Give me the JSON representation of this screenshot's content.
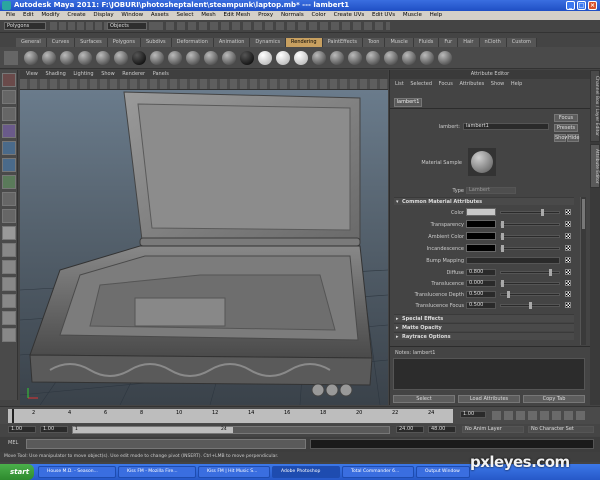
{
  "window": {
    "title": "Autodesk Maya 2011: F:\\JOBURI\\photosheptalent\\steampunk\\laptop.mb* --- lambert1",
    "minimize": "_",
    "maximize": "□",
    "close": "×"
  },
  "menubar": [
    "File",
    "Edit",
    "Modify",
    "Create",
    "Display",
    "Window",
    "Assets",
    "Select",
    "Mesh",
    "Edit Mesh",
    "Proxy",
    "Normals",
    "Color",
    "Create UVs",
    "Edit UVs",
    "Muscle",
    "Help"
  ],
  "status": {
    "mode": "Polygons",
    "objects_field": "Objects"
  },
  "shelf": {
    "tabs": [
      "General",
      "Curves",
      "Surfaces",
      "Polygons",
      "Subdivs",
      "Deformation",
      "Animation",
      "Dynamics",
      "Rendering",
      "PaintEffects",
      "Toon",
      "Muscle",
      "Fluids",
      "Fur",
      "Hair",
      "nCloth",
      "Custom"
    ],
    "active_tab": "Rendering"
  },
  "viewport": {
    "menu": [
      "View",
      "Shading",
      "Lighting",
      "Show",
      "Renderer",
      "Panels"
    ]
  },
  "attribute_editor": {
    "title": "Attribute Editor",
    "menu": [
      "List",
      "Selected",
      "Focus",
      "Attributes",
      "Show",
      "Help"
    ],
    "node_tab": "lambert1",
    "node_label": "lambert:",
    "node_name": "lambert1",
    "focus_btn": "Focus",
    "presets_btn": "Presets",
    "show_btn": "Show",
    "hide_btn": "Hide",
    "material_sample_label": "Material Sample",
    "type_label": "Type",
    "type_value": "Lambert",
    "sections": {
      "common": "Common Material Attributes",
      "special": "Special Effects",
      "matte": "Matte Opacity",
      "raytrace": "Raytrace Options"
    },
    "attributes": {
      "color": "Color",
      "transparency": "Transparency",
      "ambient": "Ambient Color",
      "incandescence": "Incandescence",
      "bump": "Bump Mapping",
      "diffuse": "Diffuse",
      "diffuse_value": "0.800",
      "translucence": "Translucence",
      "translucence_value": "0.000",
      "translucence_depth": "Translucence Depth",
      "translucence_depth_value": "0.500",
      "translucence_focus": "Translucence Focus",
      "translucence_focus_value": "0.500"
    },
    "notes": "Notes:  lambert1",
    "buttons": {
      "select": "Select",
      "load": "Load Attributes",
      "copy": "Copy Tab"
    }
  },
  "right_tabs": [
    "Channel Box / Layer Editor",
    "Attribute Editor"
  ],
  "timeline": {
    "ticks": [
      "1",
      "2",
      "4",
      "6",
      "8",
      "10",
      "12",
      "14",
      "16",
      "18",
      "20",
      "22",
      "24"
    ],
    "current": "1.00"
  },
  "range": {
    "start": "1.00",
    "start2": "1.00",
    "slider_start": "1",
    "slider_end": "24",
    "end": "24.00",
    "end2": "48.00",
    "anim_layer": "No Anim Layer",
    "char_set": "No Character Set"
  },
  "cmdline": {
    "label": "MEL"
  },
  "helpline": "Move Tool: Use manipulator to move object(s). Use edit mode to change pivot (INSERT). Ctrl+LMB to move perpendicular.",
  "taskbar": {
    "start": "start",
    "tasks": [
      "House M.D. - Season...",
      "Kiss FM - Mozilla Fire...",
      "Kiss FM | Hit Music S...",
      "Adobe Photoshop",
      "Total Commander 6...",
      "Output Window"
    ]
  },
  "watermark": "pxleyes.com",
  "colors": {
    "accent_tab": "#c8a060",
    "title_blue": "#2458d0",
    "taskbar_blue": "#2f66d8",
    "start_green": "#3a9c3a"
  }
}
